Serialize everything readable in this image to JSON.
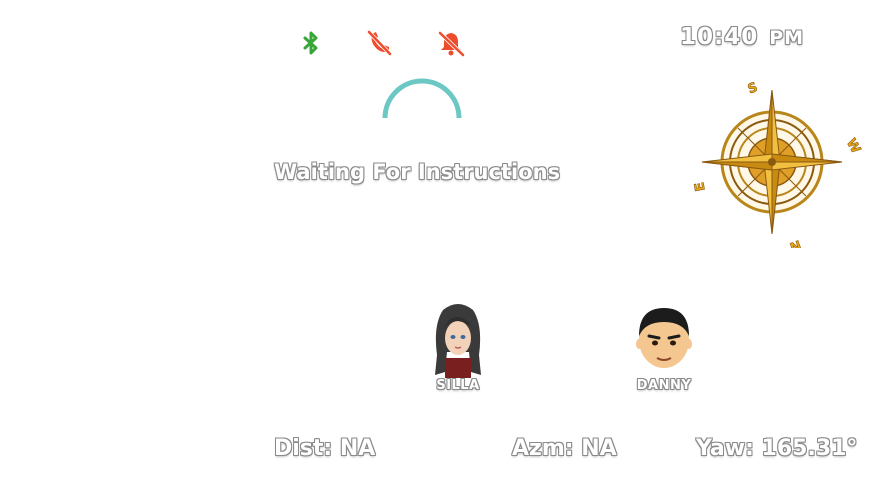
{
  "status_bar": {
    "icons": [
      "bluetooth-icon",
      "call-muted-icon",
      "notifications-muted-icon"
    ],
    "colors": {
      "bluetooth": "#3aa63a",
      "muted": "#ee4d2d"
    }
  },
  "clock": {
    "time": "10:40",
    "ampm": "PM"
  },
  "spinner": {
    "color": "#6cc8c3"
  },
  "status_message": "Waiting For Instructions",
  "compass": {
    "labels": {
      "north": "N",
      "south": "S",
      "east": "E",
      "west": "W"
    },
    "colors": {
      "star": "#e8a818",
      "ring": "#b8861a"
    }
  },
  "users": [
    {
      "name": "SILLA",
      "avatar": "female-avatar"
    },
    {
      "name": "DANNY",
      "avatar": "male-avatar"
    }
  ],
  "metrics": {
    "dist": "Dist: NA",
    "azm": "Azm: NA",
    "yaw": "Yaw: 165.31°"
  }
}
